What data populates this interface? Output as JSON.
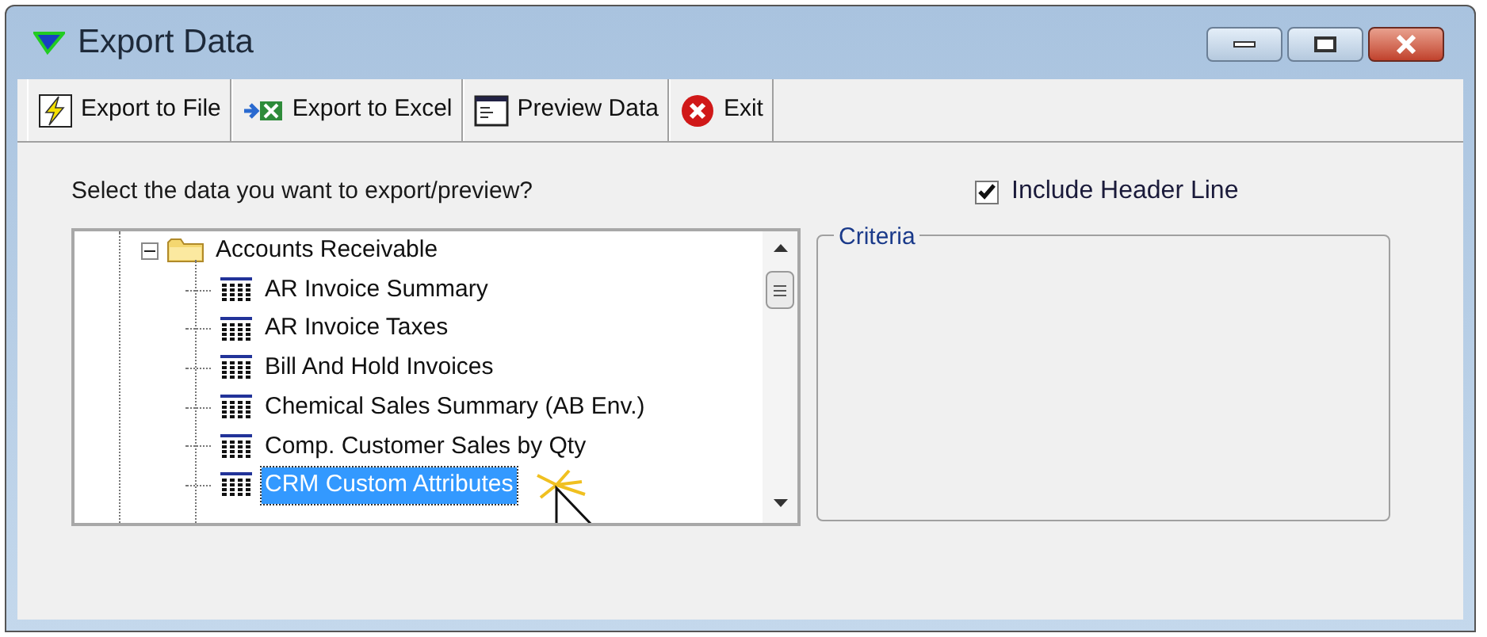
{
  "window": {
    "title": "Export Data"
  },
  "toolbar": [
    {
      "kind": "file",
      "label": "Export to File"
    },
    {
      "kind": "excel",
      "label": "Export to Excel"
    },
    {
      "kind": "preview",
      "label": "Preview Data"
    },
    {
      "kind": "exit",
      "label": "Exit"
    }
  ],
  "prompt": "Select the data you want to export/preview?",
  "include_header_line": {
    "label": "Include Header Line",
    "checked": true
  },
  "tree": [
    {
      "label": "Accounts Receivable",
      "expanded": true,
      "selected": false,
      "children": [
        {
          "label": "AR Invoice Summary",
          "selected": false
        },
        {
          "label": "AR Invoice Taxes",
          "selected": false
        },
        {
          "label": "Bill And Hold Invoices",
          "selected": false
        },
        {
          "label": "Chemical Sales Summary (AB Env.)",
          "selected": false
        },
        {
          "label": "Comp. Customer Sales by Qty",
          "selected": false
        },
        {
          "label": "CRM Custom Attributes",
          "selected": true
        }
      ]
    }
  ],
  "criteria": {
    "title": "Criteria"
  }
}
